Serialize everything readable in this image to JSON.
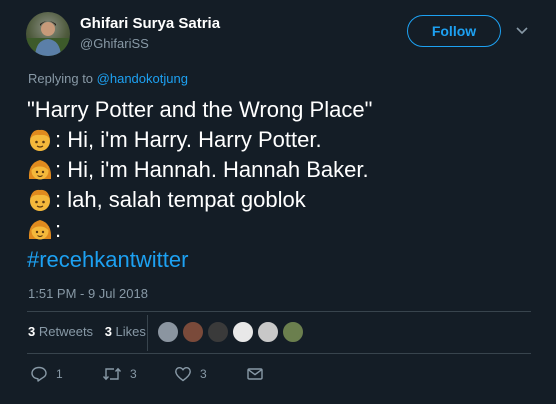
{
  "user": {
    "display_name": "Ghifari Surya Satria",
    "handle": "@GhifariSS"
  },
  "follow_label": "Follow",
  "replying": {
    "prefix": "Replying to ",
    "mention": "@handokotjung"
  },
  "tweet": {
    "title_line": "\"Harry Potter and the Wrong Place\"",
    "lines": [
      {
        "emoji": "boy",
        "text": ": Hi, i'm Harry. Harry Potter."
      },
      {
        "emoji": "girl",
        "text": ": Hi, i'm Hannah. Hannah Baker."
      },
      {
        "emoji": "boy",
        "text": ": lah, salah tempat goblok"
      },
      {
        "emoji": "girl",
        "text": ":"
      }
    ],
    "hashtag": "#recehkantwitter"
  },
  "timestamp": "1:51 PM - 9 Jul 2018",
  "stats": {
    "retweets_count": "3",
    "retweets_label": "Retweets",
    "likes_count": "3",
    "likes_label": "Likes"
  },
  "likers": [
    "#8b95a0",
    "#7a4a3a",
    "#3a3a3a",
    "#e8e8e8",
    "#c8c8c8",
    "#6b7f4e"
  ],
  "actions": {
    "reply_count": "1",
    "retweet_count": "3",
    "like_count": "3"
  },
  "colors": {
    "background": "#141d26",
    "accent": "#1da1f2",
    "muted": "#8899a6",
    "divider": "#38444d"
  }
}
